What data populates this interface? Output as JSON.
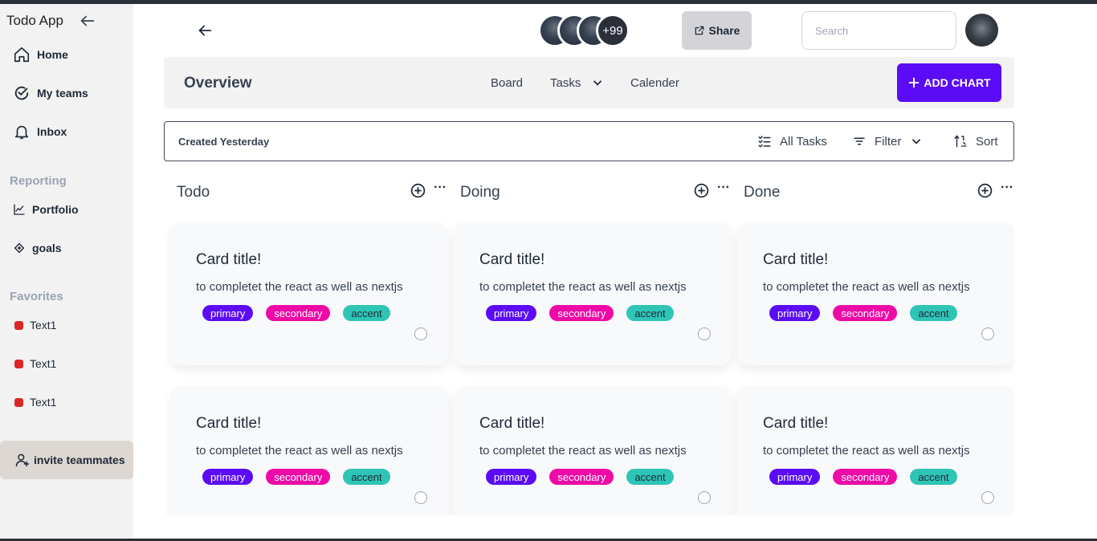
{
  "app": {
    "title": "Todo App"
  },
  "sidebar": {
    "nav": [
      {
        "label": "Home",
        "icon": "home-icon"
      },
      {
        "label": "My teams",
        "icon": "check-circle-icon"
      },
      {
        "label": "Inbox",
        "icon": "bell-icon"
      }
    ],
    "reporting_title": "Reporting",
    "reporting": [
      {
        "label": "Portfolio",
        "icon": "trend-icon"
      },
      {
        "label": "goals",
        "icon": "target-icon"
      }
    ],
    "favorites_title": "Favorites",
    "favorites": [
      {
        "label": "Text1",
        "color": "#dc2626"
      },
      {
        "label": "Text1",
        "color": "#dc2626"
      },
      {
        "label": "Text1",
        "color": "#dc2626"
      }
    ],
    "invite_label": "invite teammates"
  },
  "header": {
    "avatars_more": "+99",
    "share_label": "Share",
    "search_placeholder": "Search"
  },
  "overview": {
    "title": "Overview",
    "tabs": [
      "Board",
      "Tasks",
      "Calender"
    ],
    "add_chart_label": "ADD CHART"
  },
  "filters": {
    "created": "Created Yesterday",
    "all_tasks": "All Tasks",
    "filter": "Filter",
    "sort": "Sort"
  },
  "columns": [
    {
      "title": "Todo"
    },
    {
      "title": "Doing"
    },
    {
      "title": "Done"
    }
  ],
  "card": {
    "title": "Card title!",
    "desc": "to completet the react as well as nextjs",
    "badges": [
      "primary",
      "secondary",
      "accent"
    ]
  },
  "colors": {
    "accent": "#5b0bf5",
    "secondary": "#ee0aa7",
    "teal": "#2ec4b6",
    "favorite": "#dc2626"
  }
}
